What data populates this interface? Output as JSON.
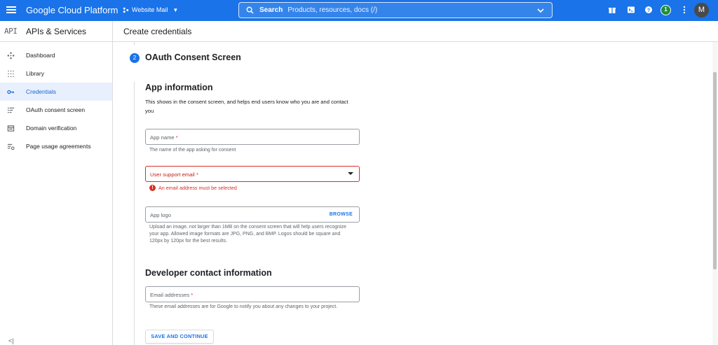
{
  "topbar": {
    "brand": "Google Cloud Platform",
    "project": "Website Mail",
    "search_label": "Search",
    "search_placeholder": "Products, resources, docs (/)",
    "notification_count": "1",
    "avatar_initial": "M"
  },
  "sidebar": {
    "api_glyph": "API",
    "title": "APIs & Services",
    "items": [
      {
        "label": "Dashboard",
        "icon": "dashboard-icon",
        "active": false
      },
      {
        "label": "Library",
        "icon": "library-icon",
        "active": false
      },
      {
        "label": "Credentials",
        "icon": "key-icon",
        "active": true
      },
      {
        "label": "OAuth consent screen",
        "icon": "consent-icon",
        "active": false
      },
      {
        "label": "Domain verification",
        "icon": "domain-icon",
        "active": false
      },
      {
        "label": "Page usage agreements",
        "icon": "settings-list-icon",
        "active": false
      }
    ],
    "collapse_glyph": "<|"
  },
  "page": {
    "title": "Create credentials",
    "step_number": "2",
    "step_title": "OAuth Consent Screen",
    "app_info": {
      "heading": "App information",
      "description": "This shows in the consent screen, and helps end users know who you are and contact you",
      "app_name_label": "App name",
      "app_name_hint": "The name of the app asking for consent",
      "support_email_label": "User support email",
      "support_email_error": "An email address must be selected",
      "app_logo_label": "App logo",
      "browse_label": "BROWSE",
      "app_logo_hint": "Upload an image, not larger than 1MB on the consent screen that will help users recognize your app. Allowed image formats are JPG, PNG, and BMP. Logos should be square and 120px by 120px for the best results."
    },
    "developer": {
      "heading": "Developer contact information",
      "email_label": "Email addresses",
      "email_hint": "These email addresses are for Google to notify you about any changes to your project."
    },
    "required_mark": "*",
    "save_button": "SAVE AND CONTINUE"
  },
  "colors": {
    "brand_blue": "#1a73e8",
    "error_red": "#d93025",
    "active_bg": "#e8f0fe"
  }
}
